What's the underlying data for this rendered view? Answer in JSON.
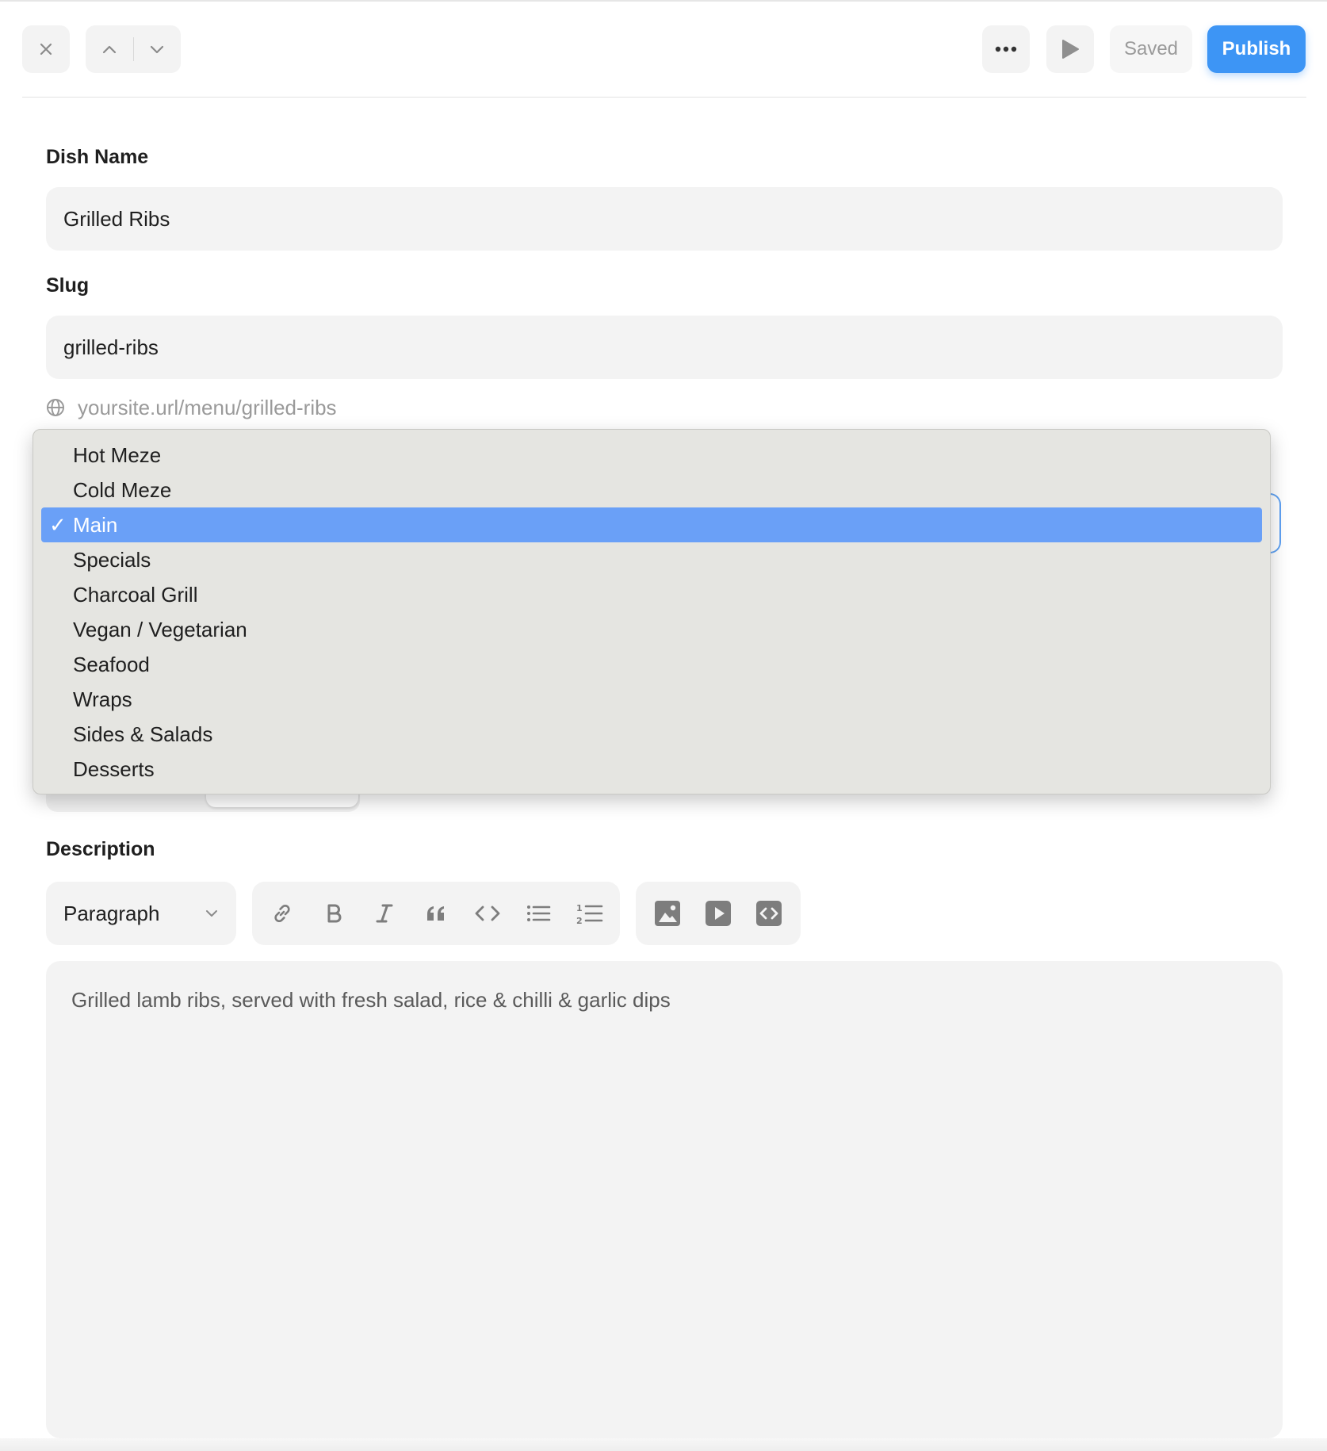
{
  "header": {
    "saved_label": "Saved",
    "publish_label": "Publish",
    "accent_color": "#3d95f5"
  },
  "form": {
    "dish_name": {
      "label": "Dish Name",
      "value": "Grilled Ribs"
    },
    "slug": {
      "label": "Slug",
      "value": "grilled-ribs",
      "url_preview": "yoursite.url/menu/grilled-ribs"
    }
  },
  "category_dropdown": {
    "options": [
      "Hot Meze",
      "Cold Meze",
      "Main",
      "Specials",
      "Charcoal Grill",
      "Vegan / Vegetarian",
      "Seafood",
      "Wraps",
      "Sides & Salads",
      "Desserts"
    ],
    "selected": "Main",
    "checkmark": "✓",
    "highlight_color": "#6aa0f7"
  },
  "description": {
    "label": "Description",
    "block_format": "Paragraph",
    "format_tools": [
      "link-icon",
      "bold-icon",
      "italic-icon",
      "quote-icon",
      "code-icon",
      "bullet-list-icon",
      "numbered-list-icon"
    ],
    "media_tools": [
      "image-icon",
      "video-icon",
      "embed-icon"
    ],
    "text": "Grilled lamb ribs, served with fresh salad, rice & chilli & garlic dips"
  }
}
